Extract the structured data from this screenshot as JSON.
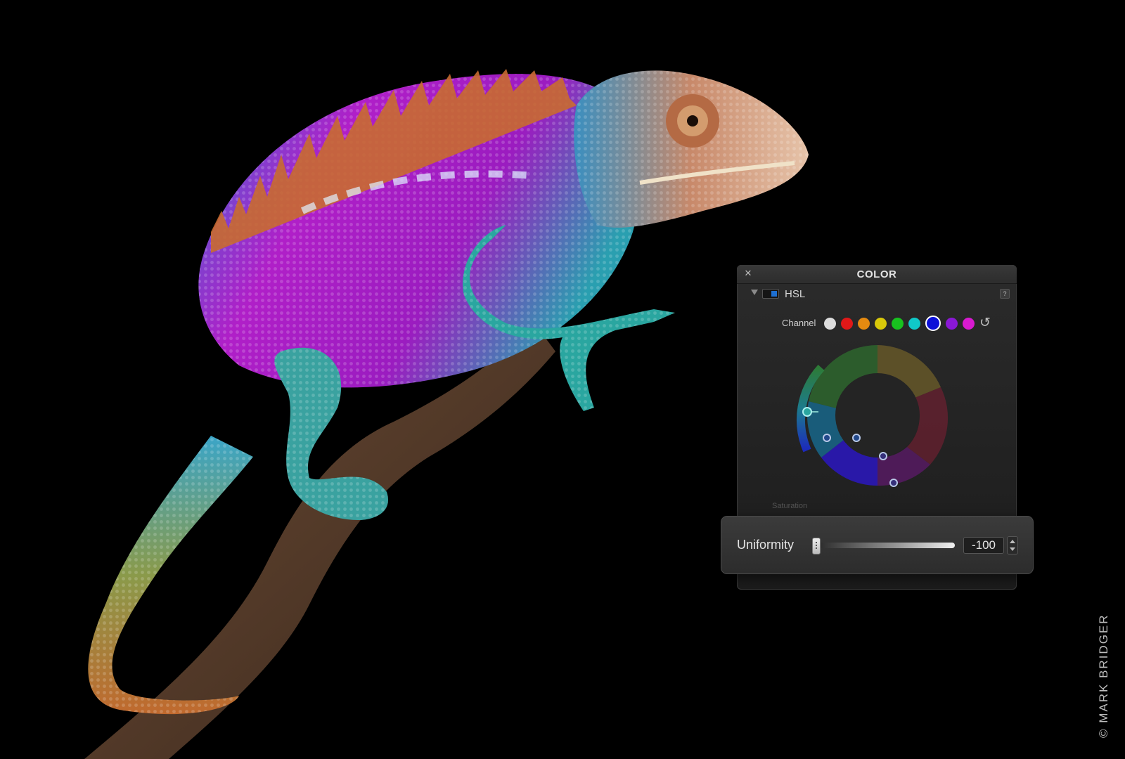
{
  "panel": {
    "title": "COLOR",
    "close_icon": "close-icon",
    "section_label": "HSL",
    "help_label": "?",
    "channel_label": "Channel",
    "channels": [
      {
        "name": "all",
        "color": "#dcdcdc"
      },
      {
        "name": "red",
        "color": "#e01818"
      },
      {
        "name": "orange",
        "color": "#e58a10"
      },
      {
        "name": "yellow",
        "color": "#d8c80a"
      },
      {
        "name": "green",
        "color": "#18c21f"
      },
      {
        "name": "aqua",
        "color": "#10c8c8"
      },
      {
        "name": "blue",
        "color": "#0c10d8"
      },
      {
        "name": "purple",
        "color": "#8a18d6"
      },
      {
        "name": "magenta",
        "color": "#d81ad0"
      }
    ],
    "selected_channel": "blue",
    "reset_icon": "reset-icon",
    "faded_label": "Saturation"
  },
  "uniformity": {
    "label": "Uniformity",
    "value": "-100"
  },
  "copyright": "© MARK BRIDGER"
}
